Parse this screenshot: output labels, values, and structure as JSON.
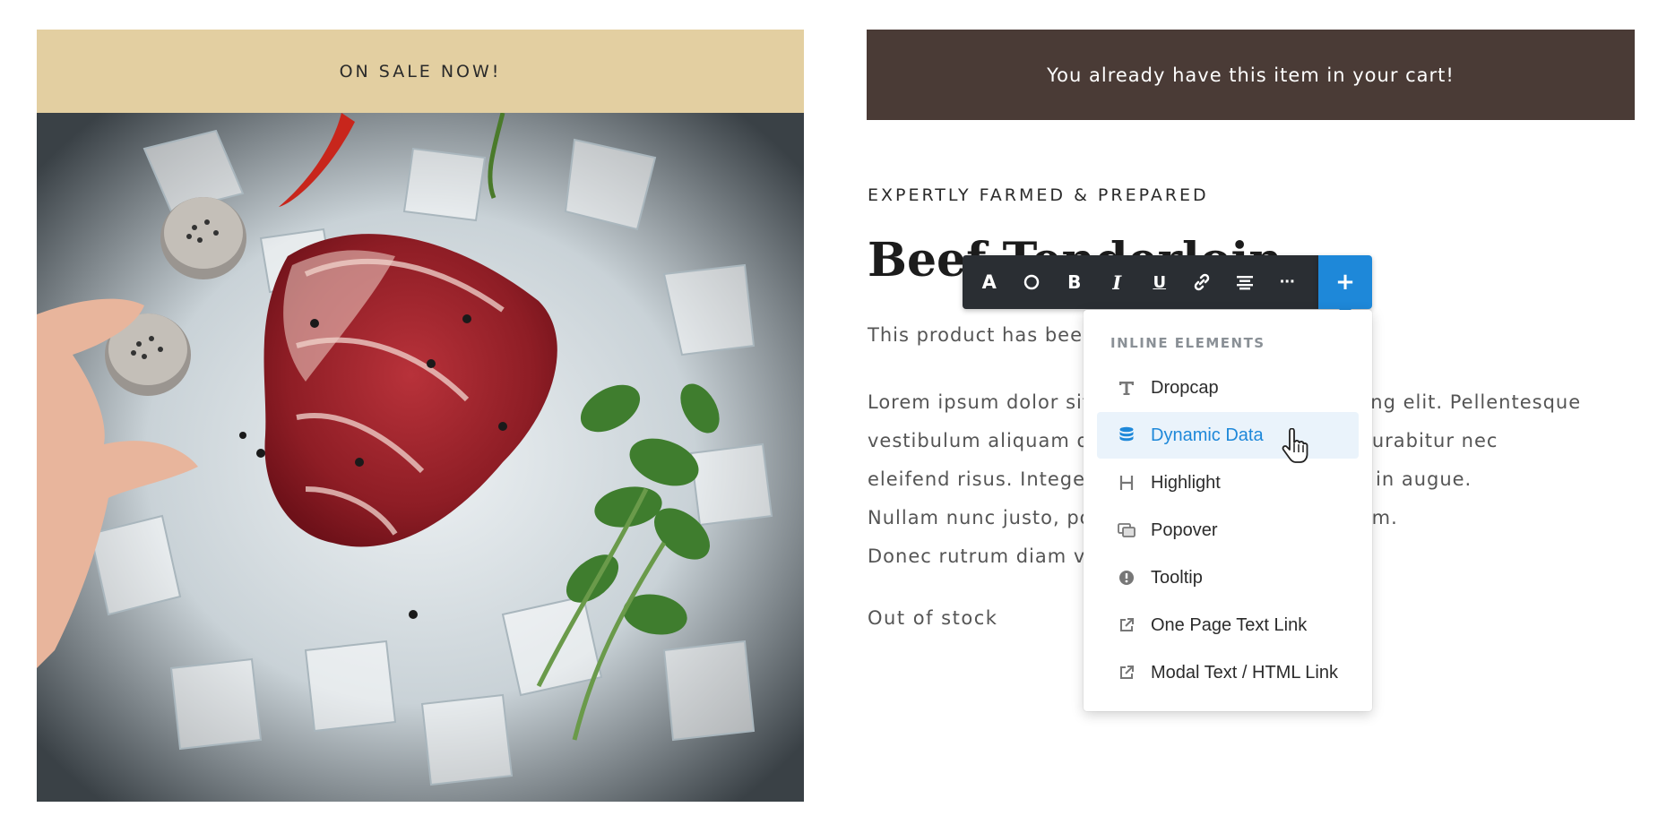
{
  "sale_banner": {
    "text": "ON SALE NOW!"
  },
  "cart_notice": {
    "text": "You already have this item in your cart!"
  },
  "product": {
    "eyebrow": "EXPERTLY FARMED & PREPARED",
    "title": "Beef Tenderloin",
    "short_desc": "This product has been",
    "body_lines": [
      "Lorem ipsum dolor sit amet, consectetur adipiscing elit. Pellentesque",
      "vestibulum aliquam orci, et dictum quam urna. Curabitur nec",
      "eleifend risus. Integer vitae pharetra ultricies eu in augue.",
      "Nullam nunc justo, porta in pharetra sit amet enim.",
      "Donec rutrum diam vel"
    ],
    "stock": "Out of stock"
  },
  "toolbar": {
    "buttons": [
      {
        "label": "A",
        "icon": "text-color-icon"
      },
      {
        "label": "",
        "icon": "circle-icon"
      },
      {
        "label": "B",
        "icon": "bold-icon"
      },
      {
        "label": "I",
        "icon": "italic-icon"
      },
      {
        "label": "U",
        "icon": "underline-icon"
      },
      {
        "label": "",
        "icon": "link-icon"
      },
      {
        "label": "",
        "icon": "align-center-icon"
      },
      {
        "label": "···",
        "icon": "more-icon"
      }
    ],
    "add_label": "+",
    "accent_color": "#1e88d9"
  },
  "dropdown": {
    "header": "INLINE ELEMENTS",
    "items": [
      {
        "label": "Dropcap",
        "icon": "text-t-icon",
        "active": false
      },
      {
        "label": "Dynamic Data",
        "icon": "database-icon",
        "active": true
      },
      {
        "label": "Highlight",
        "icon": "highlight-h-icon",
        "active": false
      },
      {
        "label": "Popover",
        "icon": "popover-icon",
        "active": false
      },
      {
        "label": "Tooltip",
        "icon": "info-circle-icon",
        "active": false
      },
      {
        "label": "One Page Text Link",
        "icon": "external-link-icon",
        "active": false
      },
      {
        "label": "Modal Text / HTML Link",
        "icon": "external-link-icon",
        "active": false
      }
    ]
  },
  "colors": {
    "sale_banner_bg": "#e3cfa1",
    "cart_notice_bg": "#4a3b36",
    "toolbar_bg": "#2a2e33"
  }
}
